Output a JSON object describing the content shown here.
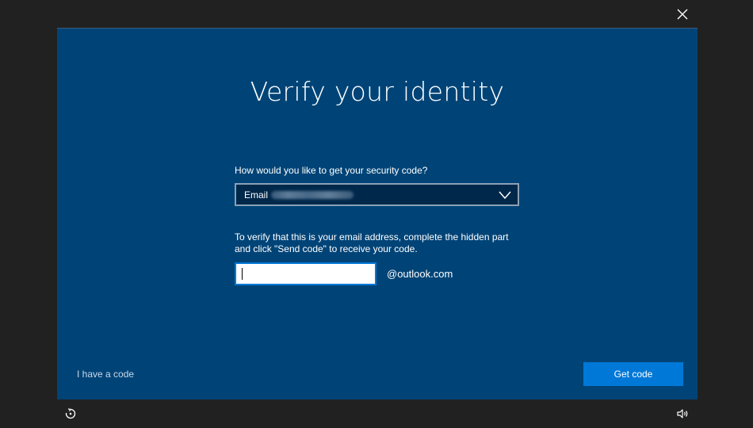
{
  "window": {
    "close_icon": "close-icon"
  },
  "dialog": {
    "title": "Verify your identity",
    "method_question": "How would you like to get your security code?",
    "method_select": {
      "selected_prefix": "Email",
      "masked_value_hidden": true,
      "icon": "chevron-down-icon"
    },
    "instructions": "To verify that this is your email address, complete the hidden part and click \"Send code\" to receive your code.",
    "email_input": {
      "value": "",
      "placeholder": ""
    },
    "email_domain": "@outlook.com",
    "have_code_link": "I have a code",
    "get_code_button": "Get code"
  },
  "taskbar": {
    "ease_of_access_icon": "ease-of-access-icon",
    "volume_icon": "volume-icon"
  },
  "colors": {
    "background": "#212121",
    "panel": "#004477",
    "accent": "#0078d7",
    "select_bg": "#00284a"
  }
}
